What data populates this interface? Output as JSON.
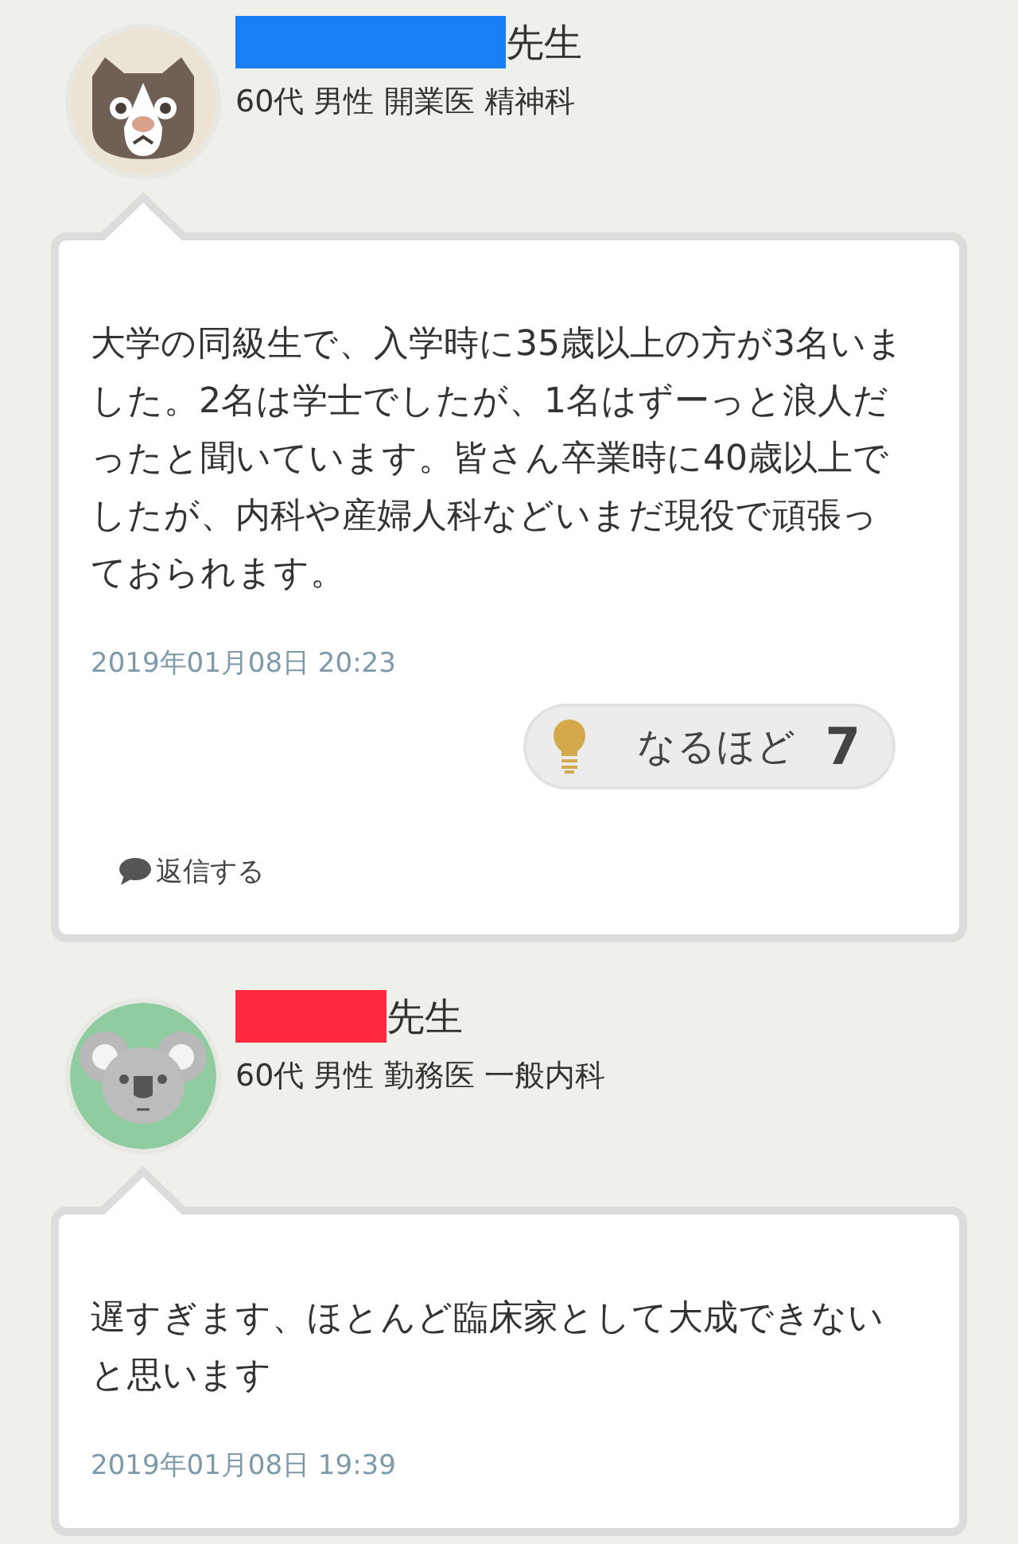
{
  "comments": [
    {
      "avatar": {
        "kind": "cat"
      },
      "redaction": {
        "color": "#1a7ff5"
      },
      "honorific": "先生",
      "profile": "60代 男性 開業医 精神科",
      "body": "大学の同級生で、入学時に35歳以上の方が3名いました。2名は学士でしたが、1名はずーっと浪人だったと聞いています。皆さん卒業時に40歳以上でしたが、内科や産婦人科などいまだ現役で頑張っておられます。",
      "date": "2019年01月08日 20:23",
      "reaction": {
        "label": "なるほど",
        "count": "7"
      },
      "reply": "返信する"
    },
    {
      "avatar": {
        "kind": "koala"
      },
      "redaction": {
        "color": "#ff2a40"
      },
      "honorific": "先生",
      "profile": "60代 男性 勤務医 一般内科",
      "body": "遅すぎます、ほとんど臨床家として大成できないと思います",
      "date": "2019年01月08日 19:39"
    }
  ]
}
